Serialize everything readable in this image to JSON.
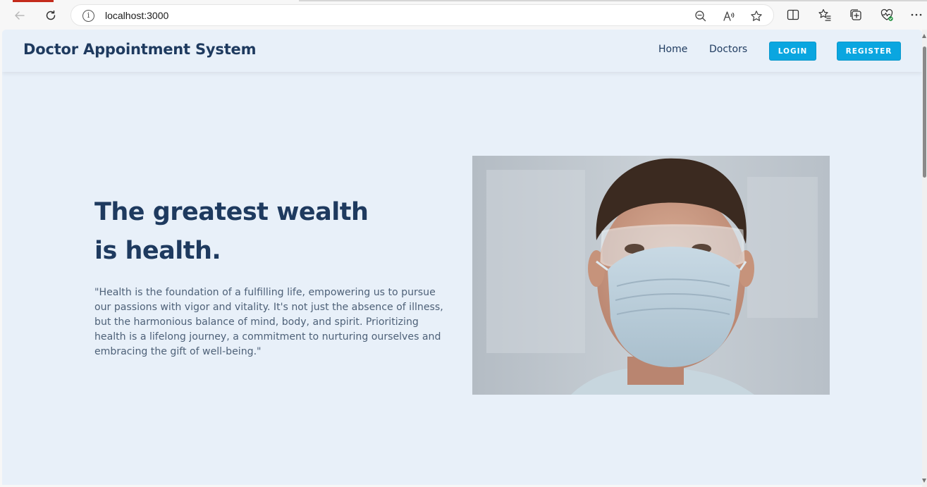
{
  "browser": {
    "url": "localhost:3000"
  },
  "header": {
    "brand": "Doctor Appointment System",
    "nav": {
      "home": "Home",
      "doctors": "Doctors",
      "login": "LOGIN",
      "register": "REGISTER"
    }
  },
  "hero": {
    "title_line1": "The greatest wealth",
    "title_line2": "is health.",
    "quote": "\"Health is the foundation of a fulfilling life, empowering us to pursue our passions with vigor and vitality. It's not just the absence of illness, but the harmonious balance of mind, body, and spirit. Prioritizing health is a lifelong journey, a commitment to nurturing ourselves and embracing the gift of well-being.\""
  },
  "colors": {
    "page_bg": "#e8f0f9",
    "brand_text": "#1e3a5f",
    "button": "#0aa6e0",
    "body_text": "#4e6178"
  },
  "icons": {
    "back": "back-arrow-icon",
    "reload": "reload-icon",
    "info": "info-icon",
    "zoom": "zoom-out-icon",
    "read_aloud": "read-aloud-icon",
    "favorite": "star-icon",
    "split": "split-screen-icon",
    "favorites": "favorites-icon",
    "collections": "collections-icon",
    "health": "browser-essentials-icon",
    "more": "more-icon"
  }
}
